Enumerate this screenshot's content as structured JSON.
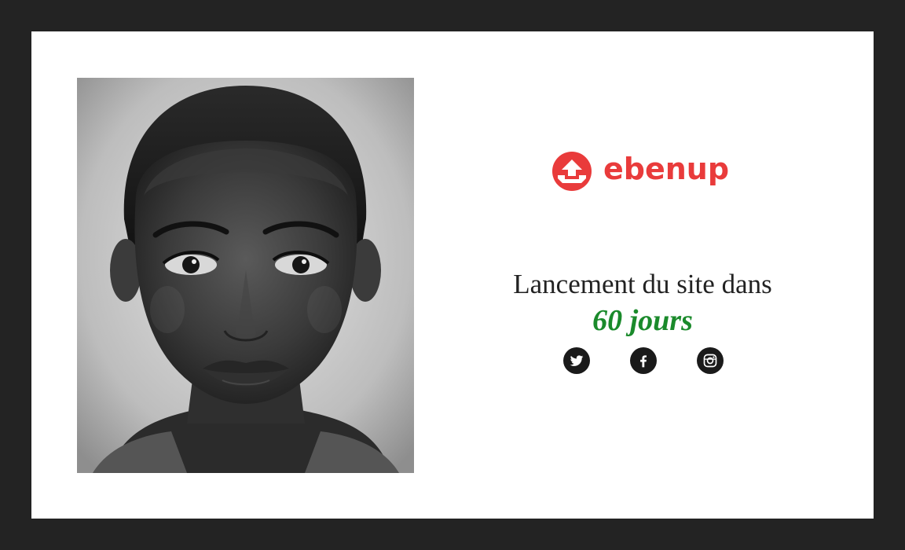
{
  "brand": {
    "name": "ebenup",
    "color": "#e93b3b",
    "logo_icon": "upload-arrow-icon"
  },
  "headline": {
    "text": "Lancement du site dans"
  },
  "countdown": {
    "text": "60 jours",
    "color": "#1a8a2b"
  },
  "hero_image": {
    "icon": "portrait-photo"
  },
  "socials": [
    {
      "icon": "twitter-icon"
    },
    {
      "icon": "facebook-icon"
    },
    {
      "icon": "instagram-icon"
    }
  ],
  "colors": {
    "page_background": "#232323",
    "card_background": "#ffffff",
    "social_background": "#1a1a1a"
  }
}
